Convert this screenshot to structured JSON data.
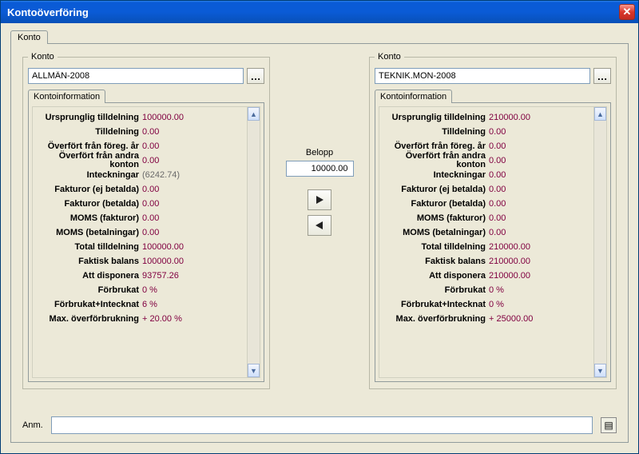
{
  "window": {
    "title": "Kontoöverföring"
  },
  "outer_tab": "Konto",
  "transfer": {
    "amount_label": "Belopp",
    "amount_value": "10000.00"
  },
  "remarks": {
    "label": "Anm."
  },
  "labels": {
    "ursprunglig_tilldelning": "Ursprunglig tilldelning",
    "tilldelning": "Tilldelning",
    "overfort_foreg": "Överfört från föreg. år",
    "overfort_andra": "Överfört från andra konton",
    "inteckningar": "Inteckningar",
    "fakturor_ej": "Fakturor (ej betalda)",
    "fakturor_bet": "Fakturor (betalda)",
    "moms_fakt": "MOMS (fakturor)",
    "moms_bet": "MOMS (betalningar)",
    "total_tilldelning": "Total tilldelning",
    "faktisk_balans": "Faktisk balans",
    "att_disponera": "Att disponera",
    "forbrukat": "Förbrukat",
    "forbrukat_inteck": "Förbrukat+Intecknat",
    "max_over": "Max. överförbrukning"
  },
  "left": {
    "legend": "Konto",
    "account": "ALLMÄN-2008",
    "info_tab": "Kontoinformation",
    "values": {
      "ursprunglig_tilldelning": "100000.00",
      "tilldelning": "0.00",
      "overfort_foreg": "0.00",
      "overfort_andra": "0.00",
      "inteckningar": "(6242.74)",
      "fakturor_ej": "0.00",
      "fakturor_bet": "0.00",
      "moms_fakt": "0.00",
      "moms_bet": "0.00",
      "total_tilldelning": "100000.00",
      "faktisk_balans": "100000.00",
      "att_disponera": "93757.26",
      "forbrukat": "0 %",
      "forbrukat_inteck": "6 %",
      "max_over": "+ 20.00 %"
    }
  },
  "right": {
    "legend": "Konto",
    "account": "TEKNIK.MON-2008",
    "info_tab": "Kontoinformation",
    "values": {
      "ursprunglig_tilldelning": "210000.00",
      "tilldelning": "0.00",
      "overfort_foreg": "0.00",
      "overfort_andra": "0.00",
      "inteckningar": "0.00",
      "fakturor_ej": "0.00",
      "fakturor_bet": "0.00",
      "moms_fakt": "0.00",
      "moms_bet": "0.00",
      "total_tilldelning": "210000.00",
      "faktisk_balans": "210000.00",
      "att_disponera": "210000.00",
      "forbrukat": "0 %",
      "forbrukat_inteck": "0 %",
      "max_over": "+ 25000.00"
    }
  }
}
